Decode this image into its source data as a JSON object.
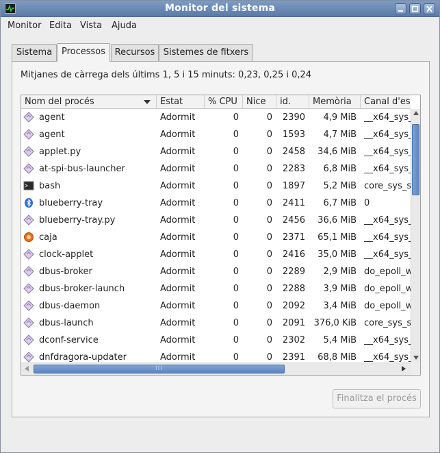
{
  "window": {
    "title": "Monitor del sistema"
  },
  "menu": [
    "Monitor",
    "Edita",
    "Vista",
    "Ajuda"
  ],
  "tabs": [
    "Sistema",
    "Processos",
    "Recursos",
    "Sistemes de fitxers"
  ],
  "active_tab": "Processos",
  "load_average": "Mitjanes de càrrega dels últims 1, 5 i 15 minuts: 0,23, 0,25 i 0,24",
  "columns": [
    "Nom del procés",
    "Estat",
    "% CPU",
    "Nice",
    "id.",
    "Memòria",
    "Canal d'es"
  ],
  "sort_column": "Nom del procés",
  "processes": [
    {
      "icon": "generic-process-icon",
      "name": "agent",
      "status": "Adormit",
      "cpu": "0",
      "nice": "0",
      "pid": "2390",
      "memory": "4,9 MiB",
      "channel": "__x64_sys_"
    },
    {
      "icon": "generic-process-icon",
      "name": "agent",
      "status": "Adormit",
      "cpu": "0",
      "nice": "0",
      "pid": "1593",
      "memory": "4,7 MiB",
      "channel": "__x64_sys_"
    },
    {
      "icon": "generic-process-icon",
      "name": "applet.py",
      "status": "Adormit",
      "cpu": "0",
      "nice": "0",
      "pid": "2458",
      "memory": "34,6 MiB",
      "channel": "__x64_sys_"
    },
    {
      "icon": "generic-process-icon",
      "name": "at-spi-bus-launcher",
      "status": "Adormit",
      "cpu": "0",
      "nice": "0",
      "pid": "2283",
      "memory": "6,8 MiB",
      "channel": "__x64_sys_"
    },
    {
      "icon": "terminal-icon",
      "name": "bash",
      "status": "Adormit",
      "cpu": "0",
      "nice": "0",
      "pid": "1897",
      "memory": "5,2 MiB",
      "channel": "core_sys_s"
    },
    {
      "icon": "bluetooth-icon",
      "name": "blueberry-tray",
      "status": "Adormit",
      "cpu": "0",
      "nice": "0",
      "pid": "2411",
      "memory": "6,7 MiB",
      "channel": "0"
    },
    {
      "icon": "generic-process-icon",
      "name": "blueberry-tray.py",
      "status": "Adormit",
      "cpu": "0",
      "nice": "0",
      "pid": "2456",
      "memory": "36,6 MiB",
      "channel": "__x64_sys_"
    },
    {
      "icon": "caja-icon",
      "name": "caja",
      "status": "Adormit",
      "cpu": "0",
      "nice": "0",
      "pid": "2371",
      "memory": "65,1 MiB",
      "channel": "__x64_sys_"
    },
    {
      "icon": "generic-process-icon",
      "name": "clock-applet",
      "status": "Adormit",
      "cpu": "0",
      "nice": "0",
      "pid": "2416",
      "memory": "35,0 MiB",
      "channel": "__x64_sys_"
    },
    {
      "icon": "generic-process-icon",
      "name": "dbus-broker",
      "status": "Adormit",
      "cpu": "0",
      "nice": "0",
      "pid": "2289",
      "memory": "2,9 MiB",
      "channel": "do_epoll_w"
    },
    {
      "icon": "generic-process-icon",
      "name": "dbus-broker-launch",
      "status": "Adormit",
      "cpu": "0",
      "nice": "0",
      "pid": "2288",
      "memory": "3,9 MiB",
      "channel": "do_epoll_w"
    },
    {
      "icon": "generic-process-icon",
      "name": "dbus-daemon",
      "status": "Adormit",
      "cpu": "0",
      "nice": "0",
      "pid": "2092",
      "memory": "3,4 MiB",
      "channel": "do_epoll_w"
    },
    {
      "icon": "generic-process-icon",
      "name": "dbus-launch",
      "status": "Adormit",
      "cpu": "0",
      "nice": "0",
      "pid": "2091",
      "memory": "376,0 KiB",
      "channel": "core_sys_s"
    },
    {
      "icon": "generic-process-icon",
      "name": "dconf-service",
      "status": "Adormit",
      "cpu": "0",
      "nice": "0",
      "pid": "2302",
      "memory": "5,4 MiB",
      "channel": "__x64_sys_"
    },
    {
      "icon": "generic-process-icon",
      "name": "dnfdragora-updater",
      "status": "Adormit",
      "cpu": "0",
      "nice": "0",
      "pid": "2391",
      "memory": "68,8 MiB",
      "channel": "__x64_sys_"
    }
  ],
  "end_process_button": "Finalitza el procés",
  "scroll_thumb_grip": "III"
}
